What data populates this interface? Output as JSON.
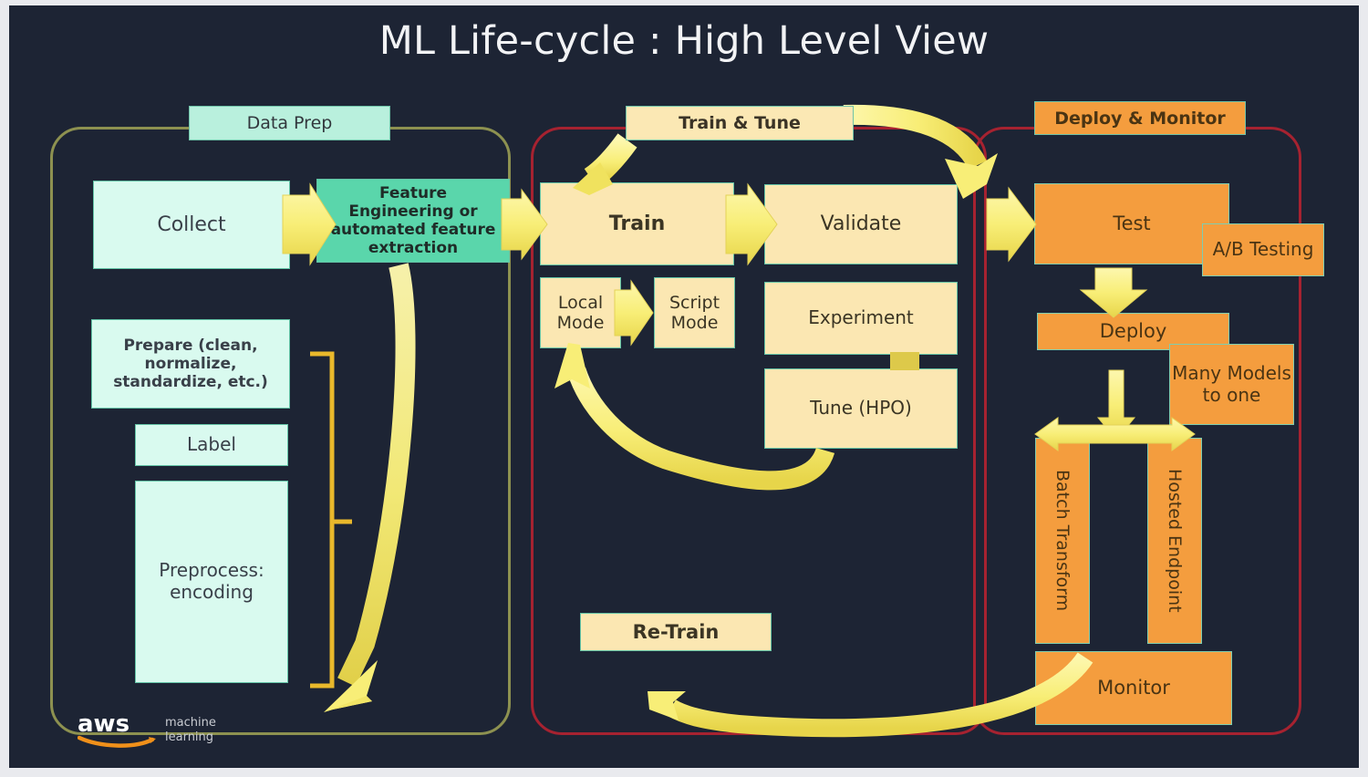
{
  "diagram": {
    "title": "ML Life-cycle : High Level View",
    "background_color": "#1d2434",
    "title_color": "#f2f3f5"
  },
  "sections": [
    {
      "id": "data-prep",
      "label": "Data Prep",
      "frame_color": "#8d9150",
      "tab_color": "#b9f0dd"
    },
    {
      "id": "train-tune",
      "label": "Train & Tune",
      "frame_color": "#a62230",
      "tab_color": "#fbe8b4"
    },
    {
      "id": "deploy-monitor",
      "label": "Deploy & Monitor",
      "frame_color": "#a62230",
      "tab_color": "#f49d3e"
    }
  ],
  "data_prep": {
    "collect": "Collect",
    "feature_engineering": "Feature Engineering or automated feature extraction",
    "prepare": "Prepare (clean, normalize, standardize, etc.)",
    "label": "Label",
    "preprocess": "Preprocess: encoding"
  },
  "train_tune": {
    "train": "Train",
    "validate": "Validate",
    "local_mode": "Local Mode",
    "script_mode": "Script Mode",
    "experiment": "Experiment",
    "tune": "Tune (HPO)",
    "retrain": "Re-Train"
  },
  "deploy_monitor": {
    "test": "Test",
    "ab_testing": "A/B Testing",
    "deploy": "Deploy",
    "many_models": "Many Models to one",
    "batch_transform": "Batch Transform",
    "hosted_endpoint": "Hosted Endpoint",
    "monitor": "Monitor"
  },
  "branding": {
    "aws_wordmark": "aws",
    "product_line1": "machine",
    "product_line2": "learning",
    "smile_color": "#f0901a",
    "wordmark_color": "#ffffff"
  },
  "colors": {
    "mint_light": "#d9faef",
    "mint_strong": "#5ad6ab",
    "cream": "#fbe7b2",
    "orange": "#f49d3e",
    "arrow_yellow": "#f7ec6e",
    "arrow_yellow_dark": "#e8d84a",
    "border_teal": "#63c3a6"
  }
}
